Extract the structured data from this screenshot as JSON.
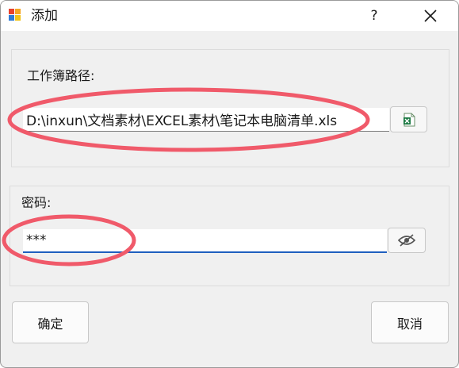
{
  "window": {
    "title": "添加",
    "help_label": "?",
    "icons": {
      "app": "app-icon",
      "close": "close-icon"
    }
  },
  "workbook": {
    "label": "工作簿路径:",
    "path_value": "D:\\inxun\\文档素材\\EXCEL素材\\笔记本电脑清单.xls",
    "browse_icon": "excel-file-icon"
  },
  "password": {
    "label": "密码:",
    "value": "***",
    "toggle_icon": "eye-slash-icon"
  },
  "buttons": {
    "ok_label": "确定",
    "cancel_label": "取消"
  },
  "colors": {
    "annotation": "#f05a6a",
    "focus_underline": "#1f5fbf"
  }
}
